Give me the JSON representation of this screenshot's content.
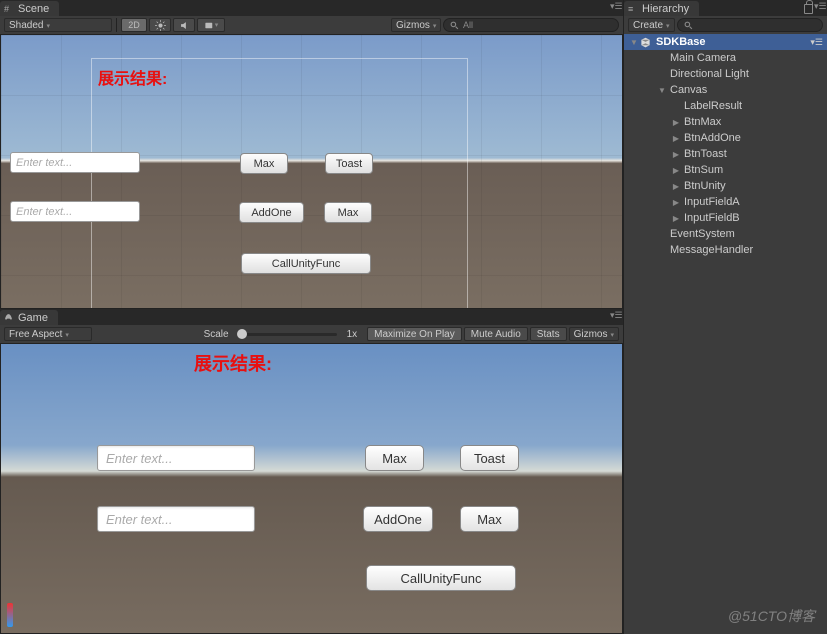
{
  "scene": {
    "tab": "Scene",
    "shading": "Shaded",
    "btn_2d": "2D",
    "gizmos": "Gizmos",
    "search_prefix": "All",
    "result_label": "展示结果:",
    "inputs": {
      "a": "Enter text...",
      "b": "Enter text..."
    },
    "buttons": {
      "max": "Max",
      "toast": "Toast",
      "addone": "AddOne",
      "max2": "Max",
      "callunity": "CallUnityFunc"
    }
  },
  "game": {
    "tab": "Game",
    "aspect": "Free Aspect",
    "scale_label": "Scale",
    "scale_val": "1x",
    "maximize": "Maximize On Play",
    "mute": "Mute Audio",
    "stats": "Stats",
    "gizmos": "Gizmos",
    "result_label": "展示结果:",
    "inputs": {
      "a": "Enter text...",
      "b": "Enter text..."
    },
    "buttons": {
      "max": "Max",
      "toast": "Toast",
      "addone": "AddOne",
      "max2": "Max",
      "callunity": "CallUnityFunc"
    }
  },
  "hierarchy": {
    "tab": "Hierarchy",
    "create": "Create",
    "scene_name": "SDKBase",
    "items": [
      {
        "name": "Main Camera",
        "depth": 2,
        "exp": ""
      },
      {
        "name": "Directional Light",
        "depth": 2,
        "exp": ""
      },
      {
        "name": "Canvas",
        "depth": 2,
        "exp": "▼"
      },
      {
        "name": "LabelResult",
        "depth": 3,
        "exp": ""
      },
      {
        "name": "BtnMax",
        "depth": 3,
        "exp": "▶"
      },
      {
        "name": "BtnAddOne",
        "depth": 3,
        "exp": "▶"
      },
      {
        "name": "BtnToast",
        "depth": 3,
        "exp": "▶"
      },
      {
        "name": "BtnSum",
        "depth": 3,
        "exp": "▶"
      },
      {
        "name": "BtnUnity",
        "depth": 3,
        "exp": "▶"
      },
      {
        "name": "InputFieldA",
        "depth": 3,
        "exp": "▶"
      },
      {
        "name": "InputFieldB",
        "depth": 3,
        "exp": "▶"
      },
      {
        "name": "EventSystem",
        "depth": 2,
        "exp": ""
      },
      {
        "name": "MessageHandler",
        "depth": 2,
        "exp": ""
      }
    ]
  },
  "watermark": "@51CTO博客"
}
